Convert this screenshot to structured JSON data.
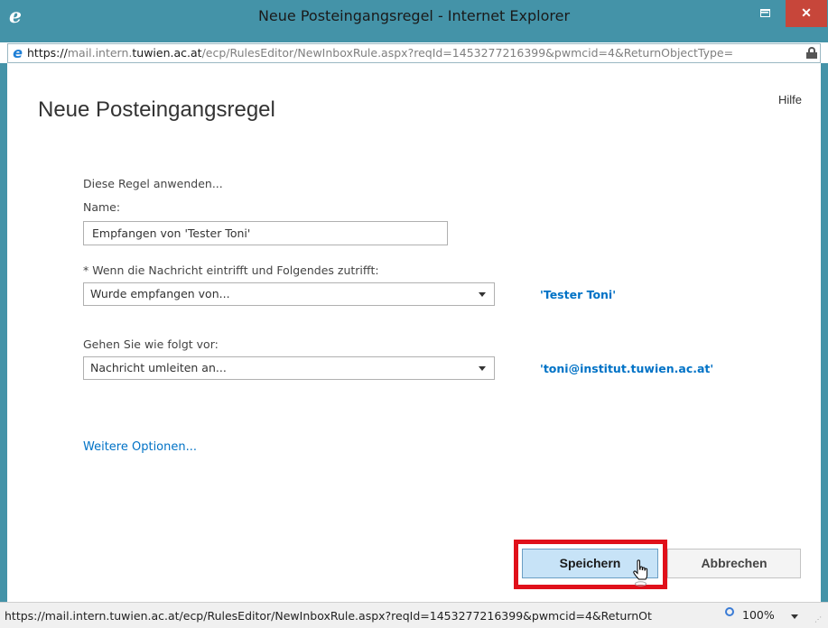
{
  "window": {
    "title": "Neue Posteingangsregel - Internet Explorer",
    "min_symbol": "–",
    "close_symbol": "✕",
    "logo_glyph": "e"
  },
  "address_bar": {
    "scheme": "https://",
    "subdomain": "mail.intern.",
    "domain": "tuwien.ac.at",
    "path": "/ecp/RulesEditor/NewInboxRule.aspx?reqId=1453277216399&pwmcid=4&ReturnObjectType="
  },
  "page": {
    "title": "Neue Posteingangsregel",
    "help": "Hilfe"
  },
  "form": {
    "apply_rule_label": "Diese Regel anwenden...",
    "name_label": "Name:",
    "name_value": "Empfangen von 'Tester Toni'",
    "condition_label": "* Wenn die Nachricht eintrifft und Folgendes zutrifft:",
    "condition_value": "Wurde empfangen von...",
    "condition_link": "'Tester Toni'",
    "action_label": "Gehen Sie wie folgt vor:",
    "action_value": "Nachricht umleiten an...",
    "action_link": "'toni@institut.tuwien.ac.at'",
    "more_options": "Weitere Optionen..."
  },
  "buttons": {
    "save": "Speichern",
    "cancel": "Abbrechen"
  },
  "status_bar": {
    "url": "https://mail.intern.tuwien.ac.at/ecp/RulesEditor/NewInboxRule.aspx?reqId=1453277216399&pwmcid=4&ReturnOt",
    "zoom": "100%"
  },
  "colors": {
    "frame": "#4493a8",
    "close_button": "#c7463a",
    "link": "#0072c6",
    "highlight": "#e0101a",
    "save_button": "#c7e3f7"
  }
}
